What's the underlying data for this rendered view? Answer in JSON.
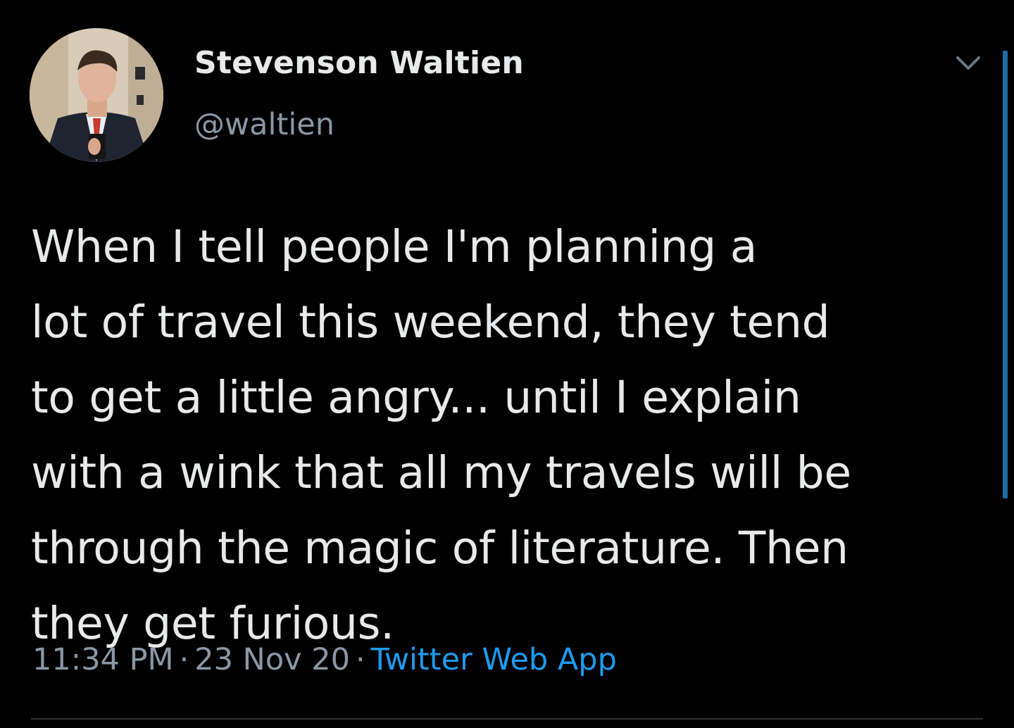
{
  "author": {
    "display_name": "Stevenson Waltien",
    "handle": "@waltien"
  },
  "tweet": {
    "text": "When I tell people I'm planning a\nlot of travel this weekend, they tend\nto get a little angry... until I explain\nwith a wink that all my travels will be\nthrough the magic of literature. Then\nthey get furious."
  },
  "meta": {
    "time": "11:34 PM",
    "separator": "·",
    "date": "23 Nov 20",
    "source": "Twitter Web App"
  },
  "icons": {
    "menu": "chevron-down-icon"
  },
  "colors": {
    "background": "#000000",
    "text": "#e7e9ea",
    "secondary_text": "#8b98a5",
    "link": "#1d9bf0",
    "scrollbar": "#1d6ea8"
  }
}
